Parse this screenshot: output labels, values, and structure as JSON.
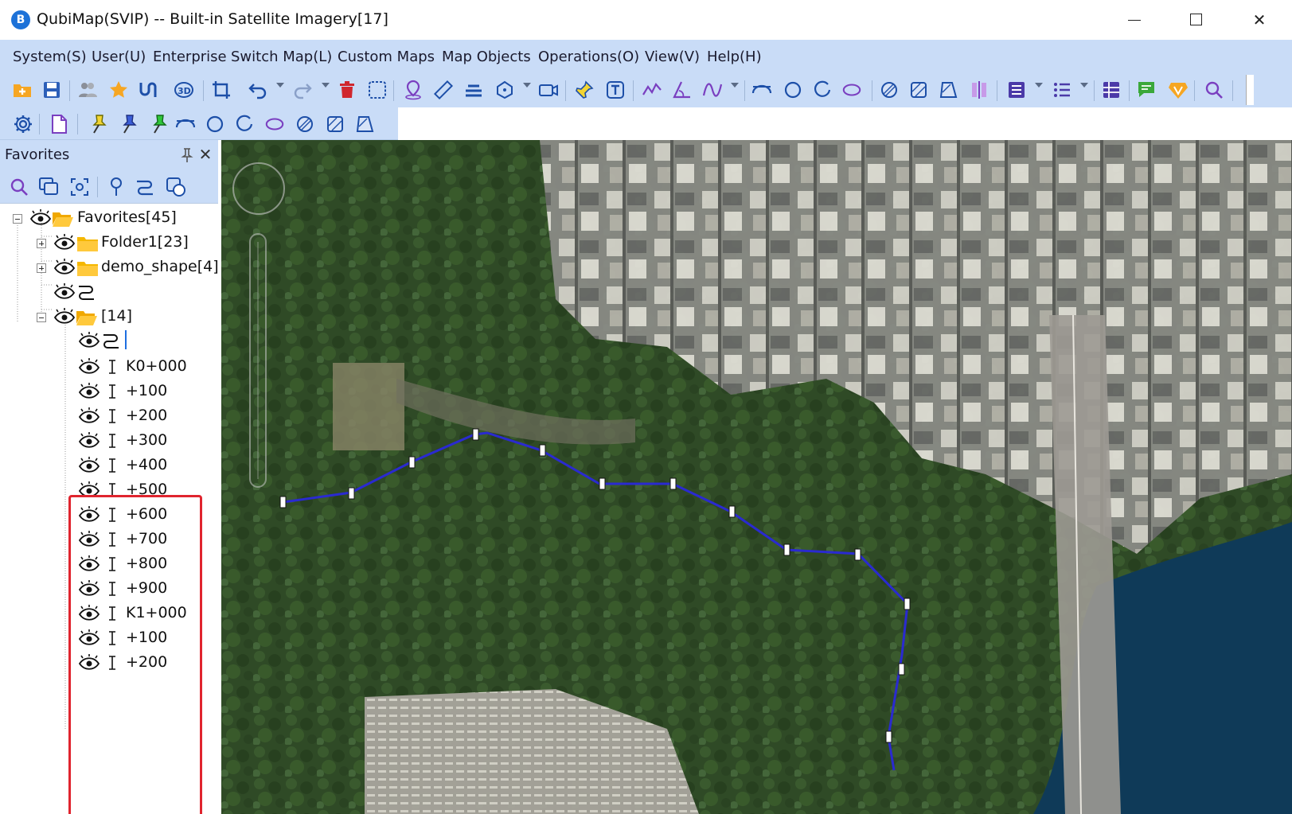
{
  "window": {
    "title": "QubiMap(SVIP) -- Built-in Satellite Imagery[17]",
    "logo_letter": "B",
    "minimize_label": "",
    "maximize_label": "",
    "close_label": "✕"
  },
  "menu": [
    {
      "id": "system",
      "label": "System(S)"
    },
    {
      "id": "user",
      "label": "User(U)"
    },
    {
      "id": "enterprise",
      "label": "Enterprise"
    },
    {
      "id": "switch-map",
      "label": "Switch Map(L)"
    },
    {
      "id": "custom-maps",
      "label": "Custom Maps"
    },
    {
      "id": "map-objects",
      "label": "Map Objects"
    },
    {
      "id": "operations",
      "label": "Operations(O)"
    },
    {
      "id": "view",
      "label": "View(V)"
    },
    {
      "id": "help",
      "label": "Help(H)"
    }
  ],
  "toolbar1_icons": [
    "open-folder-icon",
    "save-icon",
    "users-icon",
    "favorite-star-icon",
    "route-icon",
    "3d-icon",
    "crop-icon",
    "undo-icon",
    "redo-icon",
    "delete-icon",
    "select-area-icon",
    "placemark-icon",
    "ruler-icon",
    "area-measure-icon",
    "polygon-icon",
    "video-icon",
    "pin-icon",
    "text-icon",
    "polyline-icon",
    "angle-icon",
    "curve-icon",
    "arc-icon",
    "circle-icon",
    "arc-open-icon",
    "ellipse-icon",
    "hatch-circle-icon",
    "hatch-square-icon",
    "hatch-parallelogram-icon",
    "split-icon",
    "list-panel-icon",
    "bullet-list-icon",
    "grid-table-icon",
    "chat-icon",
    "vip-icon",
    "search-icon"
  ],
  "toolbar2_icons": [
    "settings-gear-icon",
    "new-document-icon",
    "yellow-pushpin-icon",
    "blue-pushpin-icon",
    "green-pushpin-icon",
    "arc-line-icon",
    "circle-icon",
    "arc-open-icon",
    "ellipse-icon",
    "hatch-circle-icon",
    "hatch-square-icon",
    "hatch-parallelogram-icon"
  ],
  "panel": {
    "title": "Favorites",
    "tools": [
      "search-icon",
      "layers-icon",
      "locate-icon",
      "placemark-icon",
      "route-icon",
      "shape-icon"
    ]
  },
  "tree": {
    "root": {
      "label": "Favorites[45]"
    },
    "folder1": {
      "label": "Folder1[23]"
    },
    "demo_shape": {
      "label": "demo_shape[4]"
    },
    "route_item": {
      "label": ""
    },
    "folder14": {
      "label": "[14]"
    },
    "sub_route": {
      "label": ""
    },
    "stakes": [
      {
        "label": "K0+000"
      },
      {
        "label": "+100"
      },
      {
        "label": "+200"
      },
      {
        "label": "+300"
      },
      {
        "label": "+400"
      },
      {
        "label": "+500"
      },
      {
        "label": "+600"
      },
      {
        "label": "+700"
      },
      {
        "label": "+800"
      },
      {
        "label": "+900"
      },
      {
        "label": "K1+000"
      },
      {
        "label": "+100"
      },
      {
        "label": "+200"
      }
    ]
  },
  "colors": {
    "menubar": "#c9dcf7",
    "route": "#2a2ad0",
    "highlight": "#e0242e",
    "folder": "#f4b400"
  }
}
